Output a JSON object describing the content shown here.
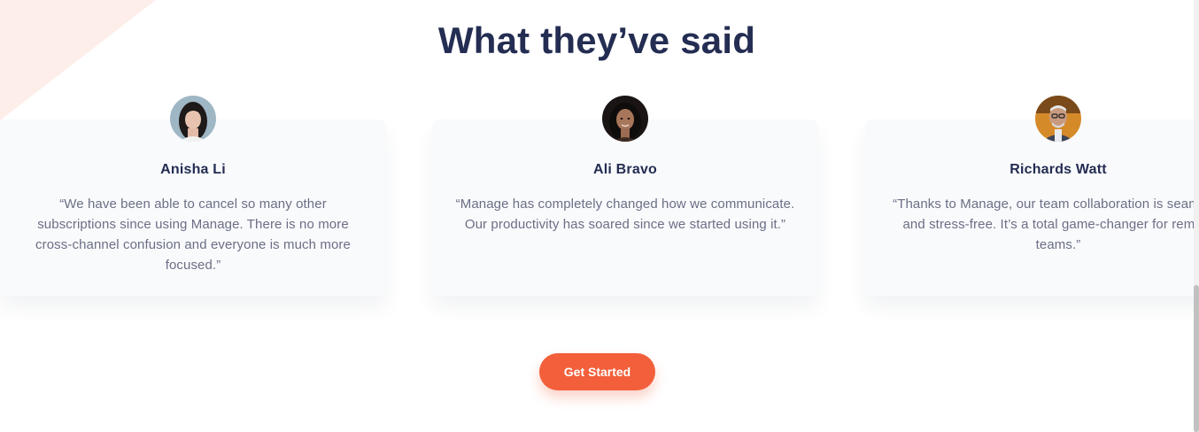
{
  "section": {
    "title": "What they’ve said"
  },
  "testimonials": [
    {
      "name": "Anisha Li",
      "quote": "“We have been able to cancel so many other subscriptions since using Manage. There is no more cross-channel confusion and everyone is much more focused.”",
      "avatar": "avatar-anisha"
    },
    {
      "name": "Ali Bravo",
      "quote": "“Manage has completely changed how we communicate. Our productivity has soared since we started using it.”",
      "avatar": "avatar-ali"
    },
    {
      "name": "Richards Watt",
      "quote": "“Thanks to Manage, our team collaboration is seamless and stress-free. It’s a total game-changer for remote teams.”",
      "avatar": "avatar-richards"
    }
  ],
  "cta": {
    "label": "Get Started"
  },
  "colors": {
    "heading": "#242d52",
    "accent": "#f25f3a",
    "card_bg": "#f9fafc",
    "body_text": "#6b6f85",
    "triangle": "#fdeeea"
  }
}
